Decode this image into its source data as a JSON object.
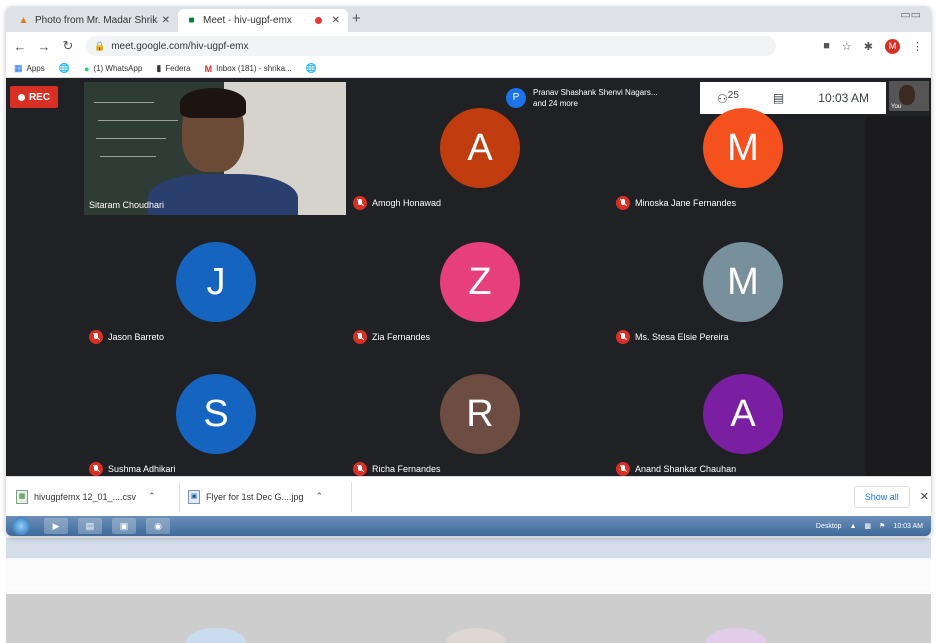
{
  "browser": {
    "tabs": [
      {
        "label": "Photo from Mr. Madar Shrikant",
        "icon": "photos-icon",
        "active": false
      },
      {
        "label": "Meet - hiv-ugpf-emx",
        "icon": "meet-icon",
        "active": true,
        "recording": true
      }
    ],
    "url": "meet.google.com/hiv-ugpf-emx",
    "profile_initial": "M",
    "bookmarks": [
      {
        "label": "Apps",
        "icon": "apps-grid-icon"
      },
      {
        "label": "",
        "icon": "globe-icon"
      },
      {
        "label": "(1) WhatsApp",
        "icon": "whatsapp-icon"
      },
      {
        "label": "Federa",
        "icon": "bookmark-icon"
      },
      {
        "label": "Inbox (181) - shrika...",
        "icon": "gmail-icon"
      },
      {
        "label": "",
        "icon": "globe-icon"
      }
    ]
  },
  "meet": {
    "rec_label": "REC",
    "presenter": {
      "initial": "P",
      "line1": "Pranav Shashank Shenvi Nagars...",
      "line2": "and 24 more"
    },
    "participants_count": "25",
    "time": "10:03 AM",
    "self_label": "You",
    "video_tile": {
      "name": "Sitaram Choudhari"
    },
    "tiles": [
      {
        "name": "Amogh Honawad",
        "initial": "A",
        "color": "#c13c0f"
      },
      {
        "name": "Minoska Jane Fernandes",
        "initial": "M",
        "color": "#f4511e"
      },
      {
        "name": "Jason Barreto",
        "initial": "J",
        "color": "#1565c0"
      },
      {
        "name": "Zia Fernandes",
        "initial": "Z",
        "color": "#e63f7b"
      },
      {
        "name": "Ms. Stesa Elsie Pereira",
        "initial": "M",
        "color": "#78909c"
      },
      {
        "name": "Sushma Adhikari",
        "initial": "S",
        "color": "#1565c0"
      },
      {
        "name": "Richa Fernandes",
        "initial": "R",
        "color": "#6d4c41"
      },
      {
        "name": "Anand Shankar Chauhan",
        "initial": "A",
        "color": "#7b1fa2"
      }
    ]
  },
  "downloads": {
    "items": [
      {
        "label": "hivugpfemx 12_01_....csv",
        "icon": "csv-file-icon"
      },
      {
        "label": "Flyer for 1st Dec G....jpg",
        "icon": "image-file-icon"
      }
    ],
    "show_all": "Show all"
  },
  "taskbar": {
    "desktop_label": "Desktop",
    "clock": "10:03 AM"
  }
}
